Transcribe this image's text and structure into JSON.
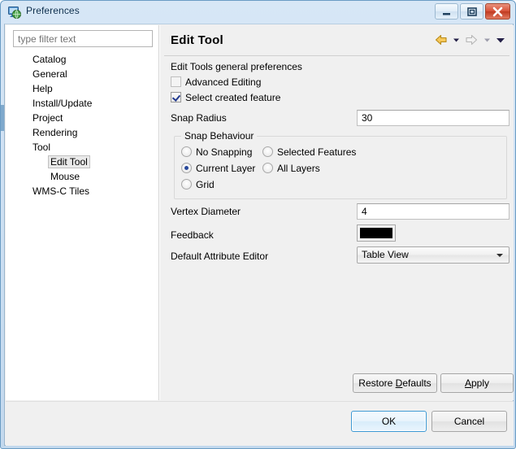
{
  "window": {
    "title": "Preferences",
    "icon": "preferences-globe-icon",
    "buttons": {
      "minimize": "minimize-button",
      "maximize": "maximize-button",
      "close": "close-button"
    }
  },
  "sidebar": {
    "filter": {
      "placeholder": "type filter text",
      "value": ""
    },
    "items": [
      {
        "label": "Catalog",
        "level": 0,
        "selected": false
      },
      {
        "label": "General",
        "level": 0,
        "selected": false
      },
      {
        "label": "Help",
        "level": 0,
        "selected": false
      },
      {
        "label": "Install/Update",
        "level": 0,
        "selected": false
      },
      {
        "label": "Project",
        "level": 0,
        "selected": false
      },
      {
        "label": "Rendering",
        "level": 0,
        "selected": false
      },
      {
        "label": "Tool",
        "level": 0,
        "selected": false
      },
      {
        "label": "Edit Tool",
        "level": 1,
        "selected": true
      },
      {
        "label": "Mouse",
        "level": 1,
        "selected": false
      },
      {
        "label": "WMS-C Tiles",
        "level": 0,
        "selected": false
      }
    ]
  },
  "page": {
    "title": "Edit Tool",
    "caption": "Edit Tools general preferences",
    "nav": {
      "back": "back-arrow-icon",
      "back_menu": "back-dropdown-icon",
      "forward": "forward-arrow-icon",
      "forward_menu": "forward-dropdown-icon",
      "menu": "view-menu-icon"
    },
    "checkboxes": [
      {
        "label": "Advanced Editing",
        "checked": false,
        "enabled": false
      },
      {
        "label": "Select created feature",
        "checked": true,
        "enabled": true
      }
    ],
    "fields": {
      "snap_radius": {
        "label": "Snap Radius",
        "value": "30"
      },
      "vertex_diameter": {
        "label": "Vertex Diameter",
        "value": "4"
      },
      "feedback": {
        "label": "Feedback",
        "color": "#000000"
      },
      "attribute_editor": {
        "label": "Default Attribute Editor",
        "value": "Table View",
        "options": [
          "Table View"
        ]
      }
    },
    "snap_behaviour": {
      "title": "Snap Behaviour",
      "options": [
        {
          "label": "No Snapping",
          "selected": false
        },
        {
          "label": "Selected Features",
          "selected": false
        },
        {
          "label": "Current Layer",
          "selected": true
        },
        {
          "label": "All Layers",
          "selected": false
        },
        {
          "label": "Grid",
          "selected": false
        }
      ]
    },
    "buttons": {
      "restore_defaults_pre": "Restore ",
      "restore_defaults_mnemonic": "D",
      "restore_defaults_post": "efaults",
      "apply_mnemonic": "A",
      "apply_post": "pply"
    }
  },
  "footer": {
    "ok": "OK",
    "cancel": "Cancel"
  },
  "colors": {
    "accent": "#3c99d4",
    "titlebar": "#cfe1f3",
    "panel": "#f0f0f0",
    "feedback_swatch": "#000000"
  }
}
